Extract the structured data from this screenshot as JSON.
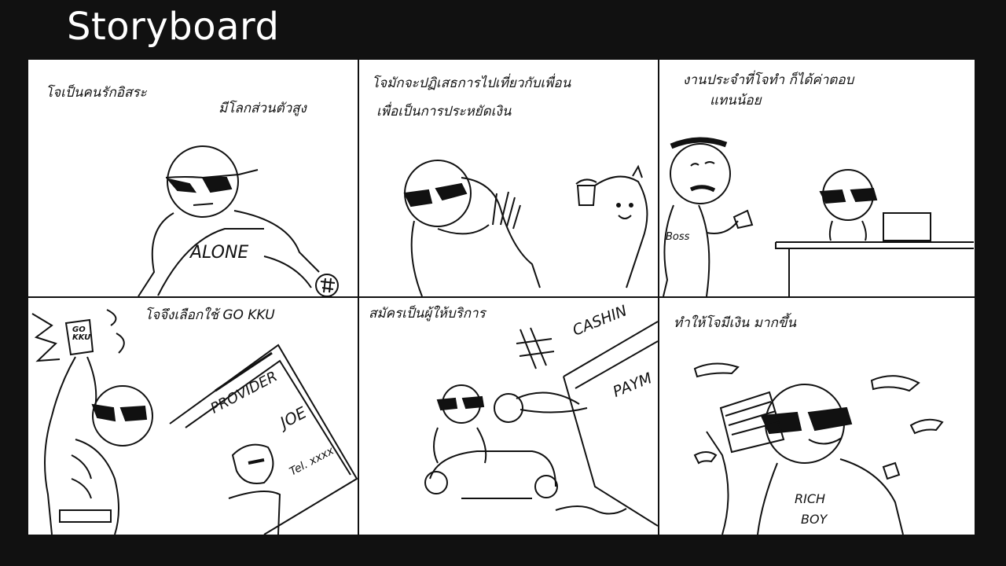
{
  "slide": {
    "title": "Storyboard"
  },
  "panels": [
    {
      "caption_lines": [
        "โจเป็นคนรักอิสระ",
        "มีโลกส่วนตัวสูง"
      ],
      "shirt_text": "ALONE"
    },
    {
      "caption_lines": [
        "โจมักจะปฏิเสธการไปเที่ยวกับเพื่อน",
        "เพื่อเป็นการประหยัดเงิน"
      ]
    },
    {
      "caption_lines": [
        "งานประจำที่โจทำ ก็ได้ค่าตอบ",
        "แทนน้อย"
      ],
      "badge_text": "Boss"
    },
    {
      "caption_lines": [
        "โจจึงเลือกใช้ GO KKU"
      ],
      "phone_text": "GO KKU",
      "card_title": "PROVIDER",
      "card_name": "JOE",
      "card_tel": "Tel. xxxx"
    },
    {
      "caption_lines": [
        "สมัครเป็นผู้ให้บริการ"
      ],
      "sign_text": "CASHIN",
      "sign_text2": "PAYM"
    },
    {
      "caption_lines": [
        "ทำให้โจมีเงิน มากขึ้น"
      ],
      "shirt_text_1": "RICH",
      "shirt_text_2": "BOY"
    }
  ]
}
